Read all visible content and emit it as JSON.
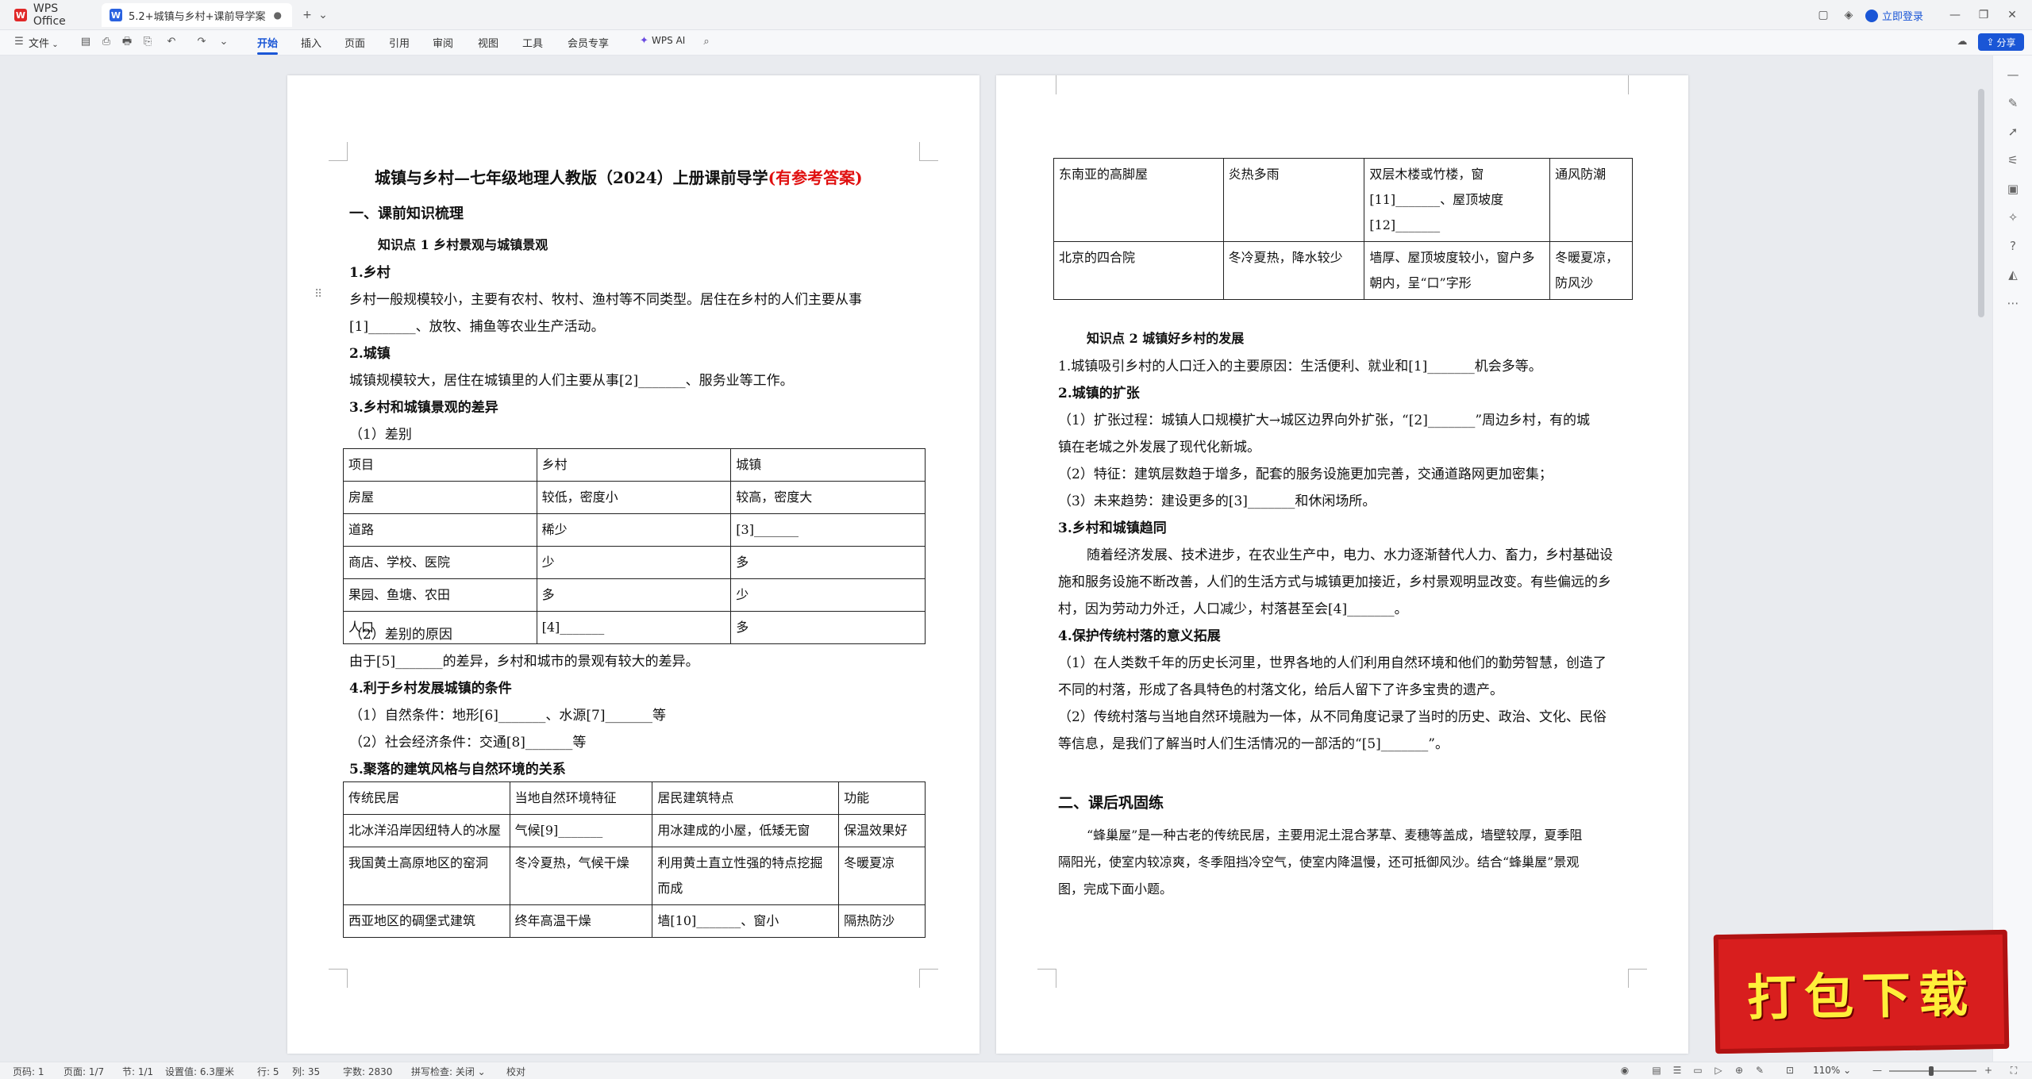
{
  "titlebar": {
    "home_tab": "WPS Office",
    "doc_tab": "5.2+城镇与乡村+课前导学案",
    "login": "立即登录"
  },
  "menu": {
    "file": "文件",
    "items": [
      "开始",
      "插入",
      "页面",
      "引用",
      "审阅",
      "视图",
      "工具",
      "会员专享"
    ],
    "wps_ai": "WPS AI",
    "share": "分享"
  },
  "page1": {
    "title_main": "城镇与乡村—七年级地理人教版（2024）上册课前导学",
    "title_red": "(有参考答案)",
    "h1": "一、课前知识梳理",
    "kp1": "知识点 1  乡村景观与城镇景观",
    "s1": "1.乡村",
    "p1a": "乡村一般规模较小，主要有农村、牧村、渔村等不同类型。居住在乡村的人们主要从事",
    "p1b": "[1]_______、放牧、捕鱼等农业生产活动。",
    "s2": "2.城镇",
    "p2": "城镇规模较大，居住在城镇里的人们主要从事[2]_______、服务业等工作。",
    "s3": "3.乡村和城镇景观的差异",
    "s3a": "（1）差别",
    "table1": [
      [
        "项目",
        "乡村",
        "城镇"
      ],
      [
        "房屋",
        "较低，密度小",
        "较高，密度大"
      ],
      [
        "道路",
        "稀少",
        "[3]_______"
      ],
      [
        "商店、学校、医院",
        "少",
        "多"
      ],
      [
        "果园、鱼塘、农田",
        "多",
        "少"
      ],
      [
        "人口",
        "[4]_______",
        "多"
      ]
    ],
    "s3b": "（2）差别的原因",
    "p3": "由于[5]_______的差异，乡村和城市的景观有较大的差异。",
    "s4": "4.利于乡村发展城镇的条件",
    "p4a": "（1）自然条件：地形[6]_______、水源[7]_______等",
    "p4b": "（2）社会经济条件：交通[8]_______等",
    "s5": "5.聚落的建筑风格与自然环境的关系",
    "table2": [
      [
        "传统民居",
        "当地自然环境特征",
        "居民建筑特点",
        "功能"
      ],
      [
        "北冰洋沿岸因纽特人的冰屋",
        "气候[9]_______",
        "用冰建成的小屋，低矮无窗",
        "保温效果好"
      ],
      [
        "我国黄土高原地区的窑洞",
        "冬冷夏热，气候干燥",
        "利用黄土直立性强的特点挖掘而成",
        "冬暖夏凉"
      ],
      [
        "西亚地区的碉堡式建筑",
        "终年高温干燥",
        "墙[10]_______、窗小",
        "隔热防沙"
      ]
    ]
  },
  "page2": {
    "table3": [
      [
        "东南亚的高脚屋",
        "炎热多雨",
        "双层木楼或竹楼，窗[11]_______、屋顶坡度[12]_______",
        "通风防潮"
      ],
      [
        "北京的四合院",
        "冬冷夏热，降水较少",
        "墙厚、屋顶坡度较小，窗户多朝内，呈“口”字形",
        "冬暖夏凉，防风沙"
      ]
    ],
    "kp2": "知识点 2  城镇好乡村的发展",
    "q1": "1.城镇吸引乡村的人口迁入的主要原因：生活便利、就业和[1]_______机会多等。",
    "q2": "2.城镇的扩张",
    "q2a": "（1）扩张过程：城镇人口规模扩大→城区边界向外扩张，“[2]_______”周边乡村，有的城",
    "q2a2": "镇在老城之外发展了现代化新城。",
    "q2b": "（2）特征：建筑层数趋于增多，配套的服务设施更加完善，交通道路网更加密集；",
    "q2c": "（3）未来趋势：建设更多的[3]_______和休闲场所。",
    "q3": "3.乡村和城镇趋同",
    "q3a": "随着经济发展、技术进步，在农业生产中，电力、水力逐渐替代人力、畜力，乡村基础设",
    "q3b": "施和服务设施不断改善，人们的生活方式与城镇更加接近，乡村景观明显改变。有些偏远的乡",
    "q3c": "村，因为劳动力外迁，人口减少，村落甚至会[4]_______。",
    "q4": "4.保护传统村落的意义拓展",
    "q4a": "（1）在人类数千年的历史长河里，世界各地的人们利用自然环境和他们的勤劳智慧，创造了",
    "q4b": "不同的村落，形成了各具特色的村落文化，给后人留下了许多宝贵的遗产。",
    "q4c": "（2）传统村落与当地自然环境融为一体，从不同角度记录了当时的历史、政治、文化、民俗",
    "q4d": "等信息，是我们了解当时人们生活情况的一部活的“[5]_______”。",
    "h2": "二、课后巩固练",
    "r1": "“蜂巢屋”是一种古老的传统民居，主要用泥土混合茅草、麦穗等盖成，墙壁较厚，夏季阻",
    "r2": "隔阳光，使室内较凉爽，冬季阻挡冷空气，使室内降温慢，还可抵御风沙。结合“蜂巢屋”景观",
    "r3": "图，完成下面小题。"
  },
  "status": {
    "page_num": "页码: 1",
    "page_count": "页面: 1/7",
    "section": "节: 1/1",
    "setting": "设置值: 6.3厘米",
    "row": "行: 5",
    "col": "列: 35",
    "words": "字数: 2830",
    "spell": "拼写检查: 关闭",
    "proof": "校对",
    "zoom": "110%"
  },
  "promo": "打包下载"
}
